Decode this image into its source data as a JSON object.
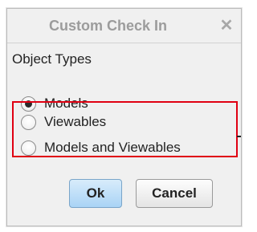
{
  "dialog": {
    "title": "Custom Check In",
    "close_glyph": "✕",
    "section_label": "Object Types",
    "options": [
      {
        "label": "Models",
        "checked": true
      },
      {
        "label": "Viewables",
        "checked": false
      },
      {
        "label": "Models and Viewables",
        "checked": false
      }
    ],
    "ok_label": "Ok",
    "cancel_label": "Cancel"
  },
  "annotation": {
    "highlight_color": "#e00012"
  },
  "colors": {
    "ok_button": "#a9d3f5",
    "title_text": "#9c9c9c"
  }
}
